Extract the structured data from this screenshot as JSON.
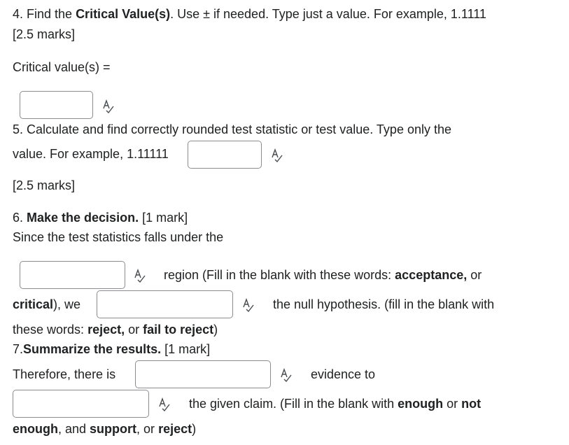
{
  "q4": {
    "prefix": "4. Find the ",
    "bold": "Critical Value(s)",
    "suffix": ". Use ± if needed. Type just a value. For example, 1.1111",
    "marks": "[2.5 marks]",
    "answer_label": "Critical value(s) =",
    "answer_value": ""
  },
  "q5": {
    "line1": "5. Calculate and find correctly rounded test statistic or test value. Type only the",
    "line2": "value. For example, 1.11111",
    "answer_value": "",
    "marks": "[2.5 marks]"
  },
  "q6": {
    "prefix": "6. ",
    "bold": "Make the decision.",
    "marks": " [1 mark]",
    "line2": "Since the test statistics falls under the",
    "blank1_value": "",
    "after_blank1": "region (Fill in the blank with these words: ",
    "word_acceptance": "acceptance,",
    "or1": " or",
    "word_critical": "critical",
    "after_critical": "), we",
    "blank2_value": "",
    "after_blank2": "the null hypothesis. (fill in the blank with",
    "these_words": "these words: ",
    "word_reject": "reject,",
    "or2": " or ",
    "word_fail": "fail to reject",
    "close": ")"
  },
  "q7": {
    "prefix": "7.",
    "bold": "Summarize the results.",
    "marks": " [1 mark]",
    "therefore": "Therefore, there is",
    "blank1_value": "",
    "evidence_to": "evidence to",
    "blank2_value": "",
    "after_blank2": "the given claim. (Fill in the blank with ",
    "word_enough": "enough",
    "or1": " or ",
    "word_not": "not",
    "word_enough2": "enough",
    "and": ", and ",
    "word_support": "support",
    "or2": ", or ",
    "word_reject": "reject",
    "close": ")"
  },
  "icons": {
    "spellcheck": "spellcheck-icon"
  }
}
